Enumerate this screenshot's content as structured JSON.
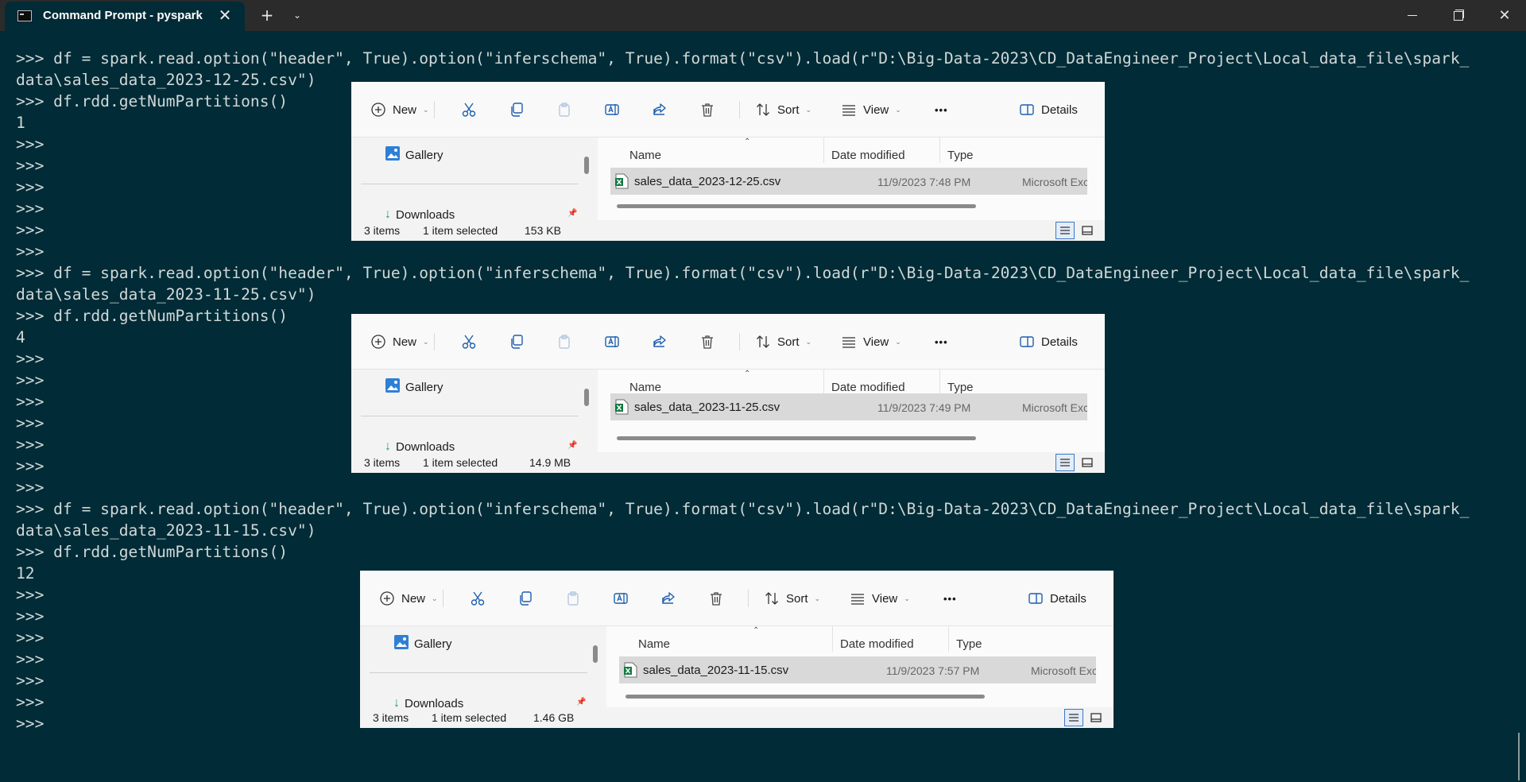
{
  "titlebar": {
    "tab_title": "Command Prompt - pyspark",
    "close_glyph": "✕",
    "new_tab_glyph": "+",
    "dropdown_glyph": "⌄",
    "window_close_glyph": "✕"
  },
  "terminal": {
    "lines": [
      ">>> df = spark.read.option(\"header\", True).option(\"inferschema\", True).format(\"csv\").load(r\"D:\\Big-Data-2023\\CD_DataEngineer_Project\\Local_data_file\\spark_",
      "data\\sales_data_2023-12-25.csv\")",
      ">>> df.rdd.getNumPartitions()",
      "1",
      ">>>",
      ">>>",
      ">>>",
      ">>>",
      ">>>",
      ">>>",
      ">>> df = spark.read.option(\"header\", True).option(\"inferschema\", True).format(\"csv\").load(r\"D:\\Big-Data-2023\\CD_DataEngineer_Project\\Local_data_file\\spark_",
      "data\\sales_data_2023-11-25.csv\")",
      ">>> df.rdd.getNumPartitions()",
      "4",
      ">>>",
      ">>>",
      ">>>",
      ">>>",
      ">>>",
      ">>>",
      ">>>",
      ">>> df = spark.read.option(\"header\", True).option(\"inferschema\", True).format(\"csv\").load(r\"D:\\Big-Data-2023\\CD_DataEngineer_Project\\Local_data_file\\spark_",
      "data\\sales_data_2023-11-15.csv\")",
      ">>> df.rdd.getNumPartitions()",
      "12",
      ">>>",
      ">>>",
      ">>>",
      ">>>",
      ">>>",
      ">>>",
      ">>>"
    ]
  },
  "explorers": [
    {
      "toolbar": {
        "new": "New",
        "sort": "Sort",
        "view": "View",
        "more": "•••",
        "details": "Details"
      },
      "nav": {
        "gallery": "Gallery",
        "downloads": "Downloads"
      },
      "columns": {
        "name": "Name",
        "date": "Date modified",
        "type": "Type"
      },
      "file": {
        "name": "sales_data_2023-12-25.csv",
        "date": "11/9/2023 7:48 PM",
        "type": "Microsoft Exc"
      },
      "status": {
        "items": "3 items",
        "selected": "1 item selected",
        "size": "153 KB"
      }
    },
    {
      "toolbar": {
        "new": "New",
        "sort": "Sort",
        "view": "View",
        "more": "•••",
        "details": "Details"
      },
      "nav": {
        "gallery": "Gallery",
        "downloads": "Downloads"
      },
      "columns": {
        "name": "Name",
        "date": "Date modified",
        "type": "Type"
      },
      "file": {
        "name": "sales_data_2023-11-25.csv",
        "date": "11/9/2023 7:49 PM",
        "type": "Microsoft Exc"
      },
      "status": {
        "items": "3 items",
        "selected": "1 item selected",
        "size": "14.9 MB"
      }
    },
    {
      "toolbar": {
        "new": "New",
        "sort": "Sort",
        "view": "View",
        "more": "•••",
        "details": "Details"
      },
      "nav": {
        "gallery": "Gallery",
        "downloads": "Downloads"
      },
      "columns": {
        "name": "Name",
        "date": "Date modified",
        "type": "Type"
      },
      "file": {
        "name": "sales_data_2023-11-15.csv",
        "date": "11/9/2023 7:57 PM",
        "type": "Microsoft Exc"
      },
      "status": {
        "items": "3 items",
        "selected": "1 item selected",
        "size": "1.46 GB"
      }
    }
  ],
  "colors": {
    "terminal_bg": "#012b36",
    "terminal_text": "#cfd8d8",
    "titlebar_bg": "#2b2b2b",
    "accent_blue": "#0067c0",
    "excel_green": "#107c41"
  },
  "icons": [
    "terminal-icon",
    "plus-icon",
    "new-icon",
    "cut-icon",
    "copy-icon",
    "paste-icon",
    "rename-icon",
    "share-icon",
    "delete-icon",
    "sort-icon",
    "view-icon",
    "more-icon",
    "details-pane-icon",
    "gallery-icon",
    "downloads-icon",
    "pin-icon",
    "excel-file-icon",
    "list-view-icon",
    "tiles-view-icon"
  ]
}
